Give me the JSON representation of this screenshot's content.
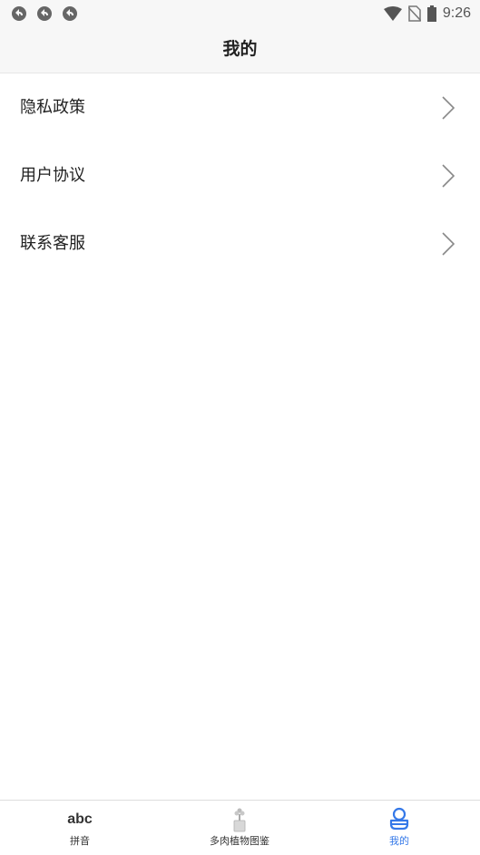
{
  "status_bar": {
    "time": "9:26",
    "notification_icons": [
      "sync-icon",
      "sync-icon",
      "sync-icon"
    ],
    "system_icons": [
      "wifi-icon",
      "no-sim-icon",
      "battery-icon"
    ]
  },
  "header": {
    "title": "我的"
  },
  "menu": {
    "items": [
      {
        "label": "隐私政策",
        "icon": "chevron-right-icon"
      },
      {
        "label": "用户协议",
        "icon": "chevron-right-icon"
      },
      {
        "label": "联系客服",
        "icon": "chevron-right-icon"
      }
    ]
  },
  "tabs": [
    {
      "icon_text": "abc",
      "label": "拼音",
      "active": false
    },
    {
      "icon": "plant-pot-icon",
      "label": "多肉植物图鉴",
      "active": false
    },
    {
      "icon": "user-icon",
      "label": "我的",
      "active": true
    }
  ],
  "colors": {
    "accent": "#3478e8",
    "header_bg": "#f7f7f7",
    "text": "#222222",
    "chevron": "#888888"
  }
}
